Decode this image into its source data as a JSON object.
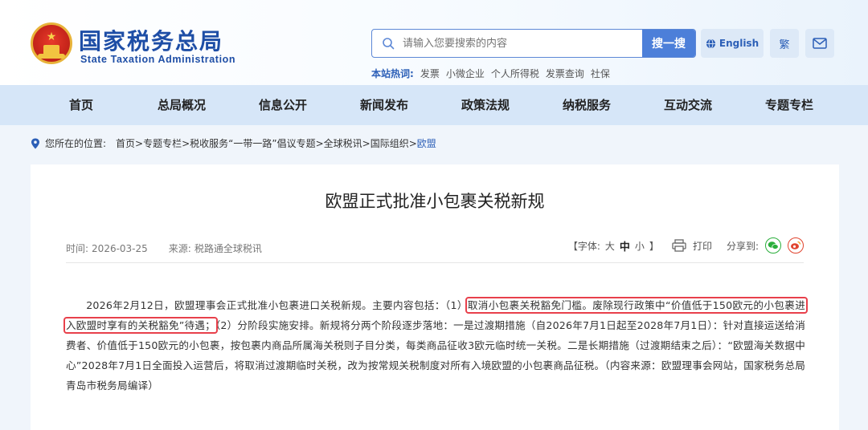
{
  "header": {
    "logo_cn": "国家税务总局",
    "logo_en": "State Taxation Administration",
    "search": {
      "placeholder": "请输入您要搜索的内容",
      "button": "搜一搜"
    },
    "hot": {
      "label": "本站热词:",
      "terms": [
        "发票",
        "小微企业",
        "个人所得税",
        "发票查询",
        "社保"
      ]
    },
    "english_button": "English",
    "trad_button": "繁"
  },
  "nav": [
    "首页",
    "总局概况",
    "信息公开",
    "新闻发布",
    "政策法规",
    "纳税服务",
    "互动交流",
    "专题专栏"
  ],
  "breadcrumb": {
    "prefix": "您所在的位置:",
    "path": "首页>专题专栏>税收服务“一带一路”倡议专题>全球税讯>国际组织>",
    "current": "欧盟"
  },
  "article": {
    "title": "欧盟正式批准小包裹关税新规",
    "time_label": "时间:",
    "time": "2026-03-25",
    "source_label": "来源:",
    "source": "税路通全球税讯",
    "font_prefix": "【字体:",
    "font_large": "大",
    "font_medium": "中",
    "font_small": "小",
    "font_suffix": "】",
    "print": "打印",
    "share": "分享到:",
    "body_part1": "2026年2月12日，欧盟理事会正式批准小包裹进口关税新规。主要内容包括：（1）",
    "highlight1": "取消小包裹关税豁免门槛。废除现行政策中“价值低于150欧元的小包裹进",
    "highlight2": "入欧盟时享有的关税豁免”待遇；",
    "body_part2": "（2）分阶段实施安排。新规将分两个阶段逐步落地：一是过渡期措施（自2026年7月1日起至2028年7月1日）：针对直接运送给消费者、价值低于150欧元的小包裹，按包裹内商品所属海关税则子目分类，每类商品征收3欧元临时统一关税。二是长期措施（过渡期结束之后）：“欧盟海关数据中心”2028年7月1日全面投入运营后，将取消过渡期临时关税，改为按常规关税制度对所有入境欧盟的小包裹商品征税。（内容来源：欧盟理事会网站，国家税务总局青岛市税务局编译）"
  },
  "colors": {
    "brand_blue": "#1e4ea6",
    "nav_bg": "#d6e6f8",
    "highlight_red": "#e8404b",
    "search_button": "#4c7fd9"
  }
}
